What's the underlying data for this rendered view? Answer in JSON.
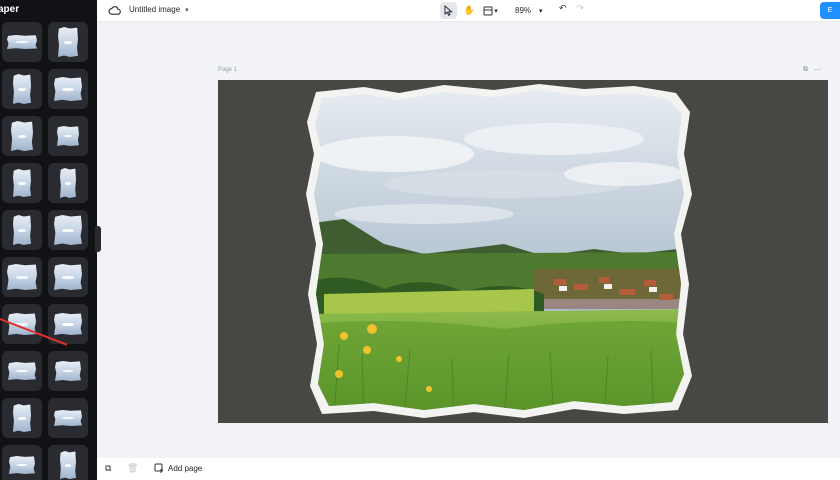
{
  "left_panel": {
    "title": "aper",
    "thumbnails": [
      {
        "name": "torn-paper-1"
      },
      {
        "name": "torn-paper-2"
      },
      {
        "name": "torn-paper-3"
      },
      {
        "name": "torn-paper-4"
      },
      {
        "name": "torn-paper-5"
      },
      {
        "name": "torn-paper-6"
      },
      {
        "name": "torn-paper-7"
      },
      {
        "name": "torn-paper-8"
      },
      {
        "name": "torn-paper-9"
      },
      {
        "name": "torn-paper-10"
      },
      {
        "name": "torn-paper-11"
      },
      {
        "name": "torn-paper-12"
      },
      {
        "name": "torn-paper-13"
      },
      {
        "name": "torn-paper-14"
      },
      {
        "name": "torn-paper-15"
      },
      {
        "name": "torn-paper-16"
      },
      {
        "name": "torn-paper-17"
      },
      {
        "name": "torn-paper-18"
      },
      {
        "name": "torn-paper-19"
      },
      {
        "name": "torn-paper-20"
      }
    ],
    "annotation_color": "#e0302f"
  },
  "topbar": {
    "doc_title": "Untitled image",
    "zoom": "89%",
    "export_label": "E",
    "accent": "#1e90ff"
  },
  "canvas": {
    "page_label": "Page 1",
    "background": "#474844",
    "photo": {
      "sky": "#b9c6d3",
      "hills": "#3d5a2e",
      "meadow": "#6aa33a",
      "flowers": "#f2c12e"
    }
  },
  "bottombar": {
    "add_page_label": "Add page"
  }
}
